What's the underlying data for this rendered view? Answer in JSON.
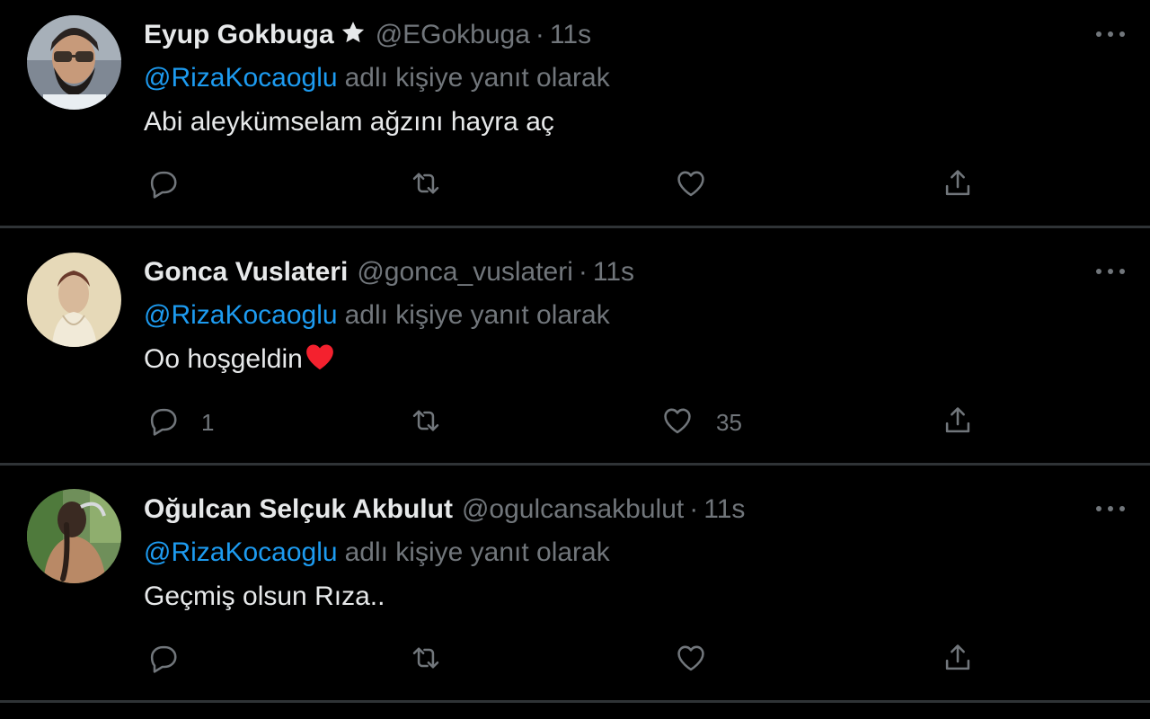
{
  "colors": {
    "background": "#000000",
    "divider": "#2f3336",
    "text_primary": "#e7e9ea",
    "text_secondary": "#71767b",
    "mention": "#1d9bf0",
    "heart": "#f4212e"
  },
  "tweets": [
    {
      "display_name": "Eyup Gokbuga",
      "verified_icon": "star-icon",
      "handle": "@EGokbuga",
      "separator": "·",
      "time": "11s",
      "reply_mention": "@RizaKocaoglu",
      "reply_text": "adlı kişiye yanıt olarak",
      "body": "Abi aleykümselam ağzını hayra aç",
      "reply_count": "",
      "like_count": ""
    },
    {
      "display_name": "Gonca Vuslateri",
      "handle": "@gonca_vuslateri",
      "separator": "·",
      "time": "11s",
      "reply_mention": "@RizaKocaoglu",
      "reply_text": "adlı kişiye yanıt olarak",
      "body": "Oo hoşgeldin",
      "body_emoji": "red-heart-emoji",
      "reply_count": "1",
      "like_count": "35"
    },
    {
      "display_name": "Oğulcan Selçuk Akbulut",
      "handle": "@ogulcansakbulut",
      "separator": "·",
      "time": "11s",
      "reply_mention": "@RizaKocaoglu",
      "reply_text": "adlı kişiye yanıt olarak",
      "body": "Geçmiş olsun Rıza..",
      "reply_count": "",
      "like_count": ""
    }
  ],
  "icons": {
    "reply": "reply-bubble-icon",
    "retweet": "retweet-icon",
    "like": "heart-outline-icon",
    "share": "share-icon",
    "more": "more-dots-icon"
  }
}
